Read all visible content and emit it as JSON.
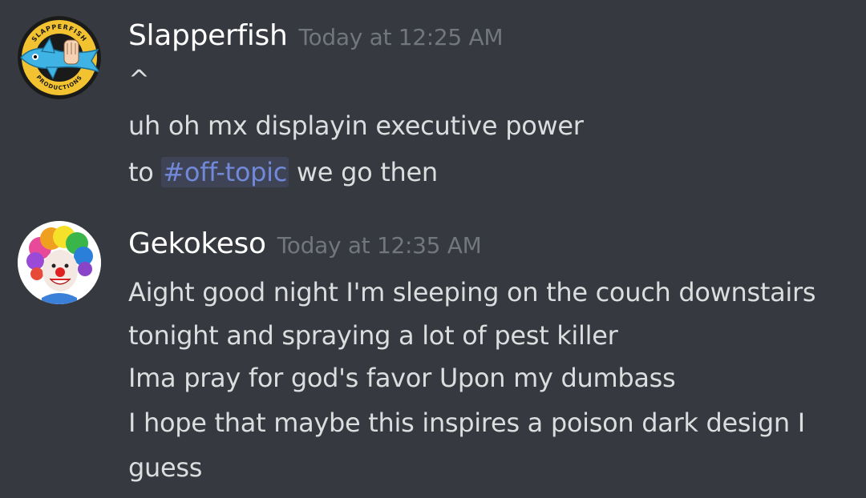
{
  "messages": [
    {
      "username": "Slapperfish",
      "timestamp": "Today at 12:25 AM",
      "avatar_text_top": "SLAPPERFISH",
      "avatar_text_bottom": "PRODUCTIONS",
      "lines": [
        "^",
        "uh oh mx displayin executive power"
      ],
      "channel_line": {
        "prefix": "to ",
        "channel": "#off-topic",
        "suffix": " we go then"
      }
    },
    {
      "username": "Gekokeso",
      "timestamp": "Today at 12:35 AM",
      "lines": [
        "Aight good night I'm sleeping on the couch downstairs",
        "tonight and spraying a lot of pest killer",
        "Ima pray for god's favor Upon my dumbass",
        "I hope that maybe this inspires a poison dark design I",
        "guess"
      ]
    }
  ],
  "colors": {
    "background": "#36393f",
    "username": "#ffffff",
    "timestamp": "#72767d",
    "message_text": "#dcddde",
    "channel_mention": "#7289da"
  }
}
